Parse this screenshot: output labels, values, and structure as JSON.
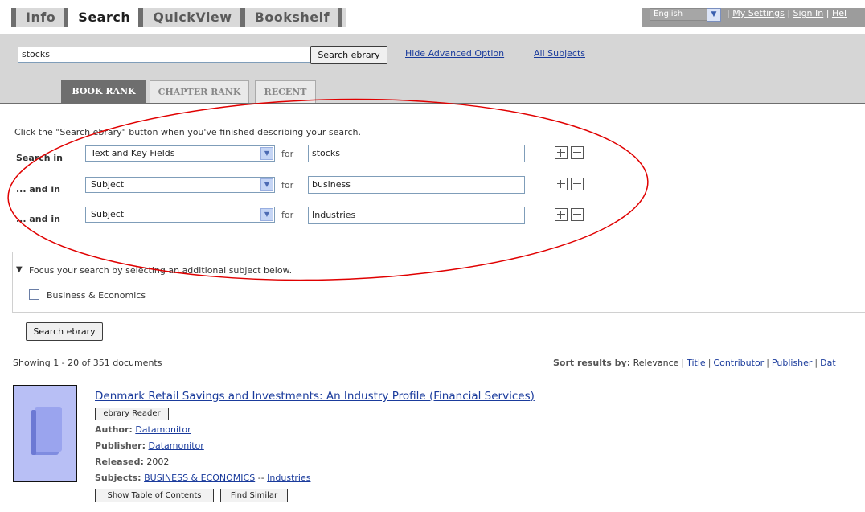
{
  "nav": {
    "tabs": [
      {
        "label": "Info"
      },
      {
        "label": "Search"
      },
      {
        "label": "QuickView"
      },
      {
        "label": "Bookshelf"
      }
    ],
    "language": "English",
    "links": [
      "My Settings",
      "Sign In",
      "Hel"
    ]
  },
  "search": {
    "query": "stocks",
    "button_label": "Search ebrary",
    "hide_advanced": "Hide Advanced Option",
    "all_subjects": "All Subjects"
  },
  "rank_tabs": [
    "BOOK RANK",
    "CHAPTER RANK",
    "RECENT"
  ],
  "advanced": {
    "hint": "Click the \"Search ebrary\" button when you've finished describing your search.",
    "for_label": "for",
    "rows": [
      {
        "label": "Search in",
        "field": "Text and Key Fields",
        "term": "stocks"
      },
      {
        "label": "... and in",
        "field": "Subject",
        "term": "business"
      },
      {
        "label": "... and in",
        "field": "Subject",
        "term": "Industries"
      }
    ]
  },
  "focus": {
    "hint": "Focus your search by selecting an additional subject below.",
    "subject": "Business & Economics"
  },
  "bottom_button": "Search ebrary",
  "results": {
    "showing": "Showing 1 - 20 of 351 documents",
    "sort_label": "Sort results by:",
    "sort_options": [
      "Relevance",
      "Title",
      "Contributor",
      "Publisher",
      "Dat"
    ],
    "item": {
      "title": "Denmark Retail Savings and Investments: An Industry Profile (Financial Services)",
      "reader_label": "ebrary Reader",
      "author_label": "Author:",
      "author": "Datamonitor",
      "publisher_label": "Publisher:",
      "publisher": "Datamonitor",
      "released_label": "Released:",
      "released": "2002",
      "subjects_label": "Subjects:",
      "subject_a": "BUSINESS & ECONOMICS",
      "subject_sep": "--",
      "subject_b": "Industries",
      "toc_button": "Show Table of Contents",
      "similar_button": "Find Similar"
    }
  },
  "colors": {
    "nav_dark": "#6e6e6e",
    "search_bg": "#d6d6d6",
    "link": "#1a3b9c",
    "annotation": "#e00000",
    "cover": "#b8bff5"
  }
}
